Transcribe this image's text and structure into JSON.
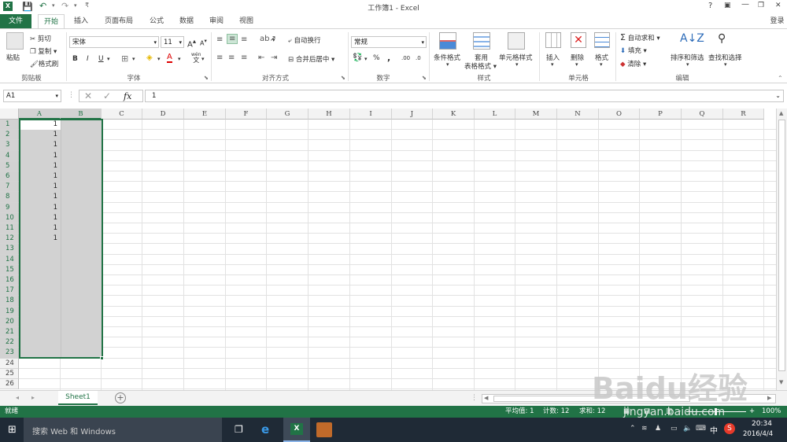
{
  "titlebar": {
    "title": "工作簿1 - Excel",
    "help": "?",
    "minimize": "—",
    "restore": "❐",
    "close": "✕",
    "signin": "登录"
  },
  "tabs": [
    "文件",
    "开始",
    "插入",
    "页面布局",
    "公式",
    "数据",
    "审阅",
    "视图"
  ],
  "ribbon": {
    "clipboard": {
      "label": "剪贴板",
      "paste": "粘贴",
      "cut": "剪切",
      "copy": "复制",
      "format_painter": "格式刷"
    },
    "font": {
      "label": "字体",
      "font_name": "宋体",
      "font_size": "11",
      "bold": "B",
      "italic": "I",
      "underline": "U",
      "grow": "A",
      "shrink": "A",
      "wen": "wén",
      "wen2": "文"
    },
    "alignment": {
      "label": "对齐方式",
      "wrap": "自动换行",
      "merge": "合并后居中"
    },
    "number": {
      "label": "数字",
      "format": "常规",
      "percent": "%",
      "comma": ",",
      "inc": ".00",
      "dec": ".0"
    },
    "styles": {
      "label": "样式",
      "conditional": "条件格式",
      "table1": "套用",
      "table2": "表格格式",
      "cell_styles": "单元格样式"
    },
    "cells": {
      "label": "单元格",
      "insert": "插入",
      "delete": "删除",
      "format": "格式"
    },
    "editing": {
      "label": "编辑",
      "autosum": "自动求和",
      "fill": "填充",
      "clear": "清除",
      "sort": "排序和筛选",
      "find": "查找和选择"
    }
  },
  "formula_bar": {
    "name_box": "A1",
    "fx": "fx",
    "value": "1"
  },
  "columns": [
    "A",
    "B",
    "C",
    "D",
    "E",
    "F",
    "G",
    "H",
    "I",
    "J",
    "K",
    "L",
    "M",
    "N",
    "O",
    "P",
    "Q",
    "R"
  ],
  "rows": [
    "1",
    "2",
    "3",
    "4",
    "5",
    "6",
    "7",
    "8",
    "9",
    "10",
    "11",
    "12",
    "13",
    "14",
    "15",
    "16",
    "17",
    "18",
    "19",
    "20",
    "21",
    "22",
    "23",
    "24",
    "25",
    "26"
  ],
  "cells_a": [
    "1",
    "1",
    "1",
    "1",
    "1",
    "1",
    "1",
    "1",
    "1",
    "1",
    "1",
    "1"
  ],
  "sheets": {
    "active": "Sheet1",
    "add": "+"
  },
  "status": {
    "mode": "就绪",
    "average": "平均值: 1",
    "count": "计数: 12",
    "sum": "求和: 12",
    "zoom": "100%",
    "minus": "-",
    "plus": "+"
  },
  "taskbar": {
    "search": "搜索 Web 和 Windows",
    "time": "20:34",
    "date": "2016/4/4",
    "ime": "中",
    "tray_s": "S"
  },
  "watermark": {
    "text": "Baidu经验",
    "url": "jingyan.baidu.com"
  },
  "colors": {
    "excel_green": "#217346",
    "selection": "#d2d2d2",
    "taskbar": "#1f2a36"
  }
}
